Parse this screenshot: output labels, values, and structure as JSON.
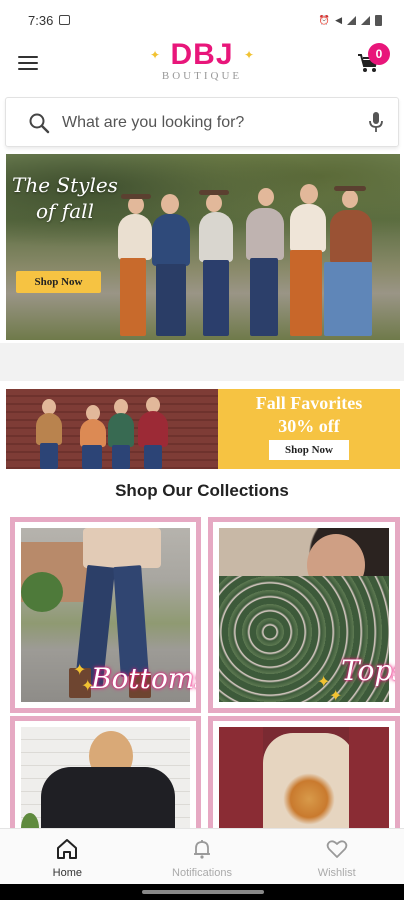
{
  "status_bar": {
    "time": "7:36"
  },
  "header": {
    "logo_main": "DBJ",
    "logo_sub": "BOUTIQUE",
    "cart_count": "0",
    "brand_color": "#e8167a",
    "accent_gold": "#f1c232"
  },
  "search": {
    "placeholder": "What are you looking for?"
  },
  "hero": {
    "script_line1": "The Styles",
    "script_line2": "of fall",
    "button_label": "Shop Now"
  },
  "promo": {
    "title": "Fall Favorites",
    "discount": "30% off",
    "button_label": "Shop Now",
    "bg_color": "#f6c342"
  },
  "collections": {
    "title": "Shop Our Collections",
    "tiles": [
      {
        "label": "Bottoms"
      },
      {
        "label": "Tops"
      },
      {
        "label": ""
      },
      {
        "label": ""
      }
    ],
    "frame_color": "#e6a9c3"
  },
  "bottom_nav": {
    "items": [
      {
        "label": "Home",
        "icon": "home-icon",
        "active": true
      },
      {
        "label": "Notifications",
        "icon": "bell-icon",
        "active": false
      },
      {
        "label": "Wishlist",
        "icon": "heart-icon",
        "active": false
      }
    ]
  }
}
